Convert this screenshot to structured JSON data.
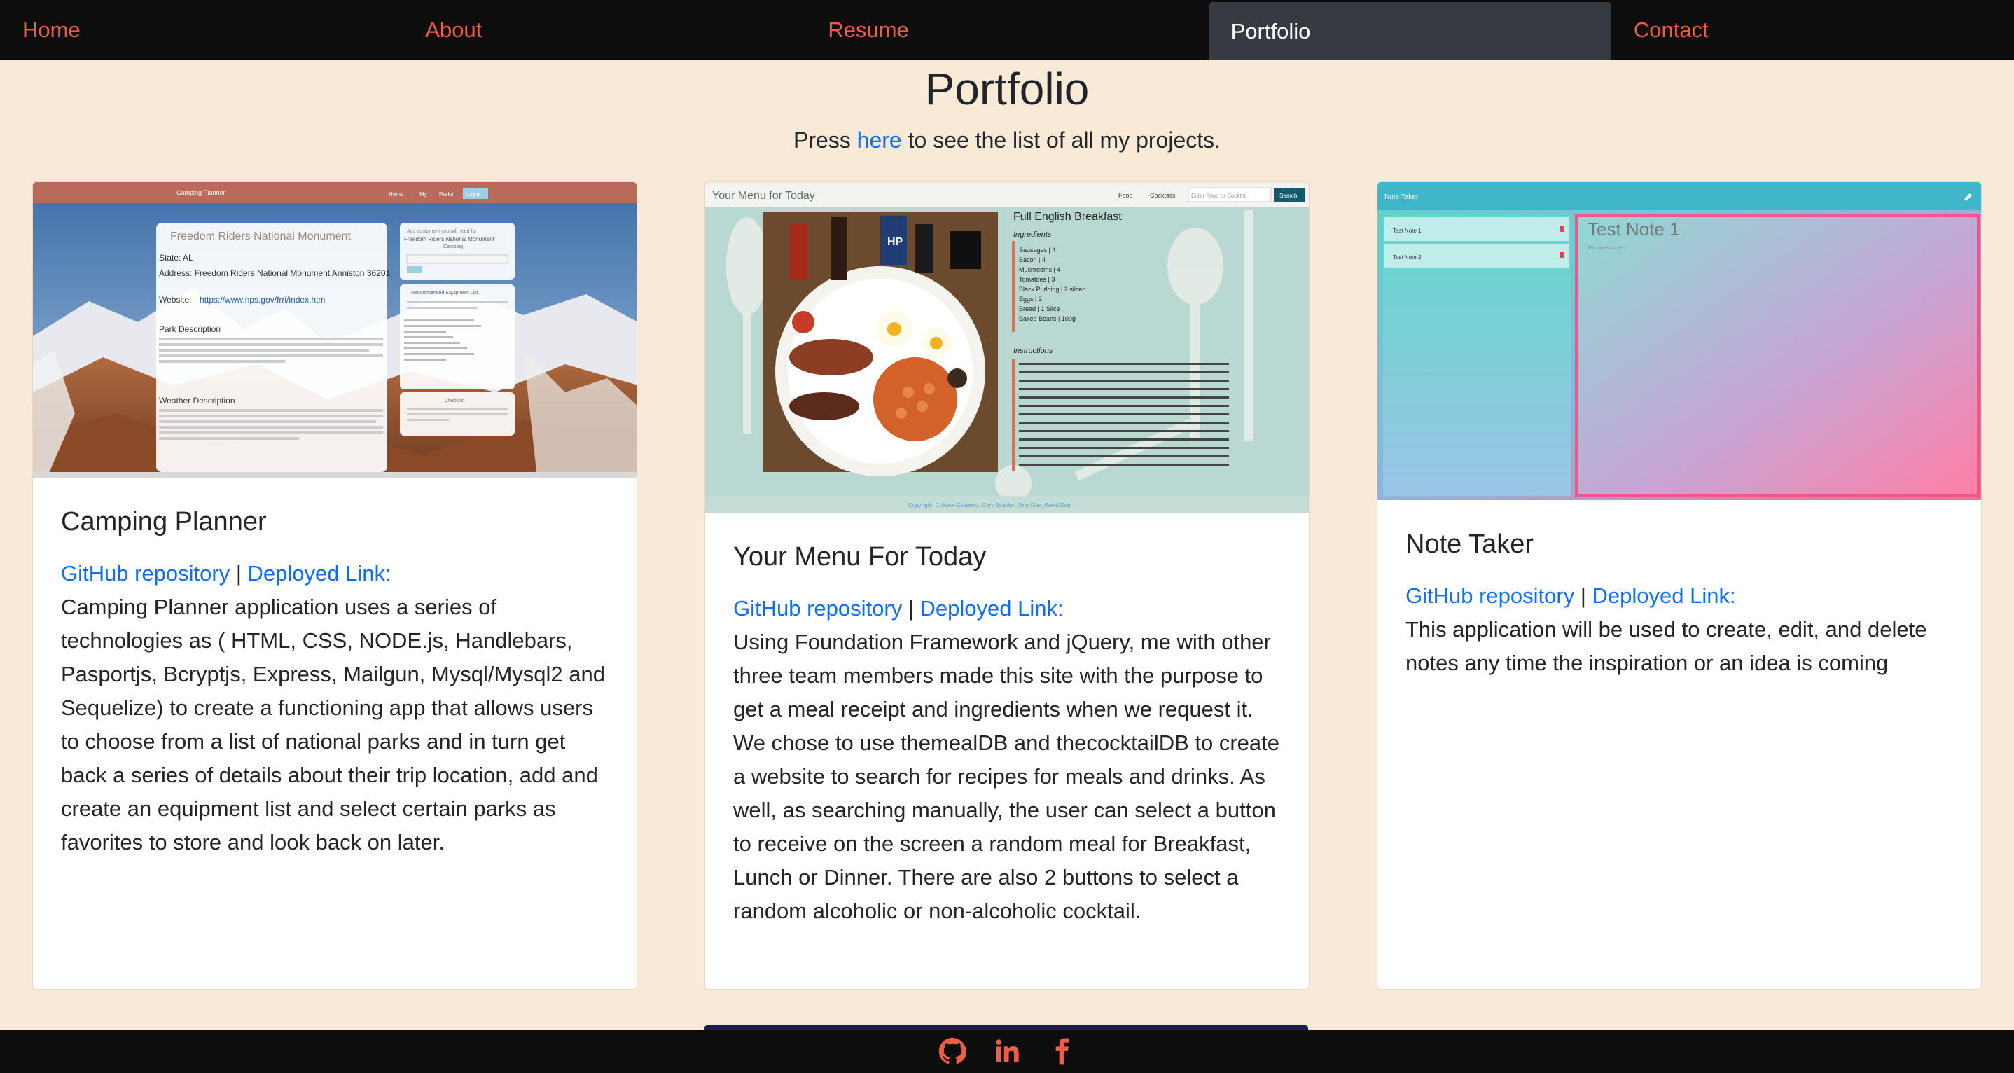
{
  "nav": {
    "items": [
      "Home",
      "About",
      "Resume",
      "Portfolio",
      "Contact"
    ],
    "active": "Portfolio"
  },
  "header": {
    "title": "Portfolio",
    "subtitle_before": "Press ",
    "subtitle_link": "here",
    "subtitle_after": " to see the list of all my projects."
  },
  "colors": {
    "background": "#f9e9d7",
    "nav_bg": "#0d0d0d",
    "nav_link": "#f05d47",
    "active_tab": "#343a40",
    "link": "#0d6efd"
  },
  "cards": [
    {
      "title": "Camping Planner",
      "github_label": "GitHub repository",
      "separator": "|",
      "deployed_label": "Deployed Link:",
      "description": "Camping Planner application uses a series of technologies as ( HTML, CSS, NODE.js, Handlebars, Pasportjs, Bcryptjs, Express, Mailgun, Mysql/Mysql2 and Sequelize) to create a functioning app that allows users to choose from a list of national parks and in turn get back a series of details about their trip location, add and create an equipment list and select certain parks as favorites to store and look back on later.",
      "shot": {
        "app_title": "Camping Planner",
        "menu": [
          "Home",
          "My",
          "Parks",
          "Log In"
        ],
        "park_name": "Freedom Riders National Monument",
        "state": "State: AL",
        "address": "Address: Freedom Riders National Monument Anniston 36201",
        "website_label": "Website:",
        "website": "https://www.nps.gov/frri/index.htm",
        "park_desc_title": "Park Description",
        "weather_title": "Weather Description",
        "equip_title": "Add equipment you will need for Freedom Riders National Monument",
        "equip_sub": "Camping",
        "recommended": "Recommended Equipment List",
        "checklist": "Checklist"
      }
    },
    {
      "title": "Your Menu For Today",
      "github_label": "GitHub repository",
      "separator": "|",
      "deployed_label": "Deployed Link:",
      "description": "Using Foundation Framework and jQuery, me with other three team members made this site with the purpose to get a meal receipt and ingredients when we request it. We chose to use themealDB and thecocktailDB to create a website to search for recipes for meals and drinks. As well, as searching manually, the user can select a button to receive on the screen a random meal for Breakfast, Lunch or Dinner. There are also 2 buttons to select a random alcoholic or non-alcoholic cocktail.",
      "shot": {
        "app_title": "Your Menu for Today",
        "menu": [
          "Food",
          "Cocktails"
        ],
        "search_placeholder": "Enter Food or Cocktail",
        "search_button": "Search",
        "meal_name": "Full English Breakfast",
        "ingredients_title": "Ingredients",
        "ingredients": [
          "Sausages | 4",
          "Bacon | 4",
          "Mushrooms | 4",
          "Tomatoes | 3",
          "Black Pudding | 2 sliced",
          "Eggs | 2",
          "Bread | 1 Slice",
          "Baked Beans | 100g"
        ],
        "instructions_title": "Instructions",
        "copyright": "Copyright: Cristina Gutierrez, Cory Scanlon, Eric Oller, Pavel Dab"
      }
    },
    {
      "title": "Note Taker",
      "github_label": "GitHub repository",
      "separator": "|",
      "deployed_label": "Deployed Link:",
      "description": "This application will be used to create, edit, and delete notes any time the inspiration or an idea is coming",
      "shot": {
        "app_title": "Note Taker",
        "notes": [
          "Test Note 1",
          "Test Note 2"
        ],
        "note_title": "Test Note 1",
        "note_body": "This note is a test"
      }
    }
  ],
  "footer": {
    "icons": [
      "github-icon",
      "linkedin-icon",
      "facebook-icon"
    ]
  }
}
